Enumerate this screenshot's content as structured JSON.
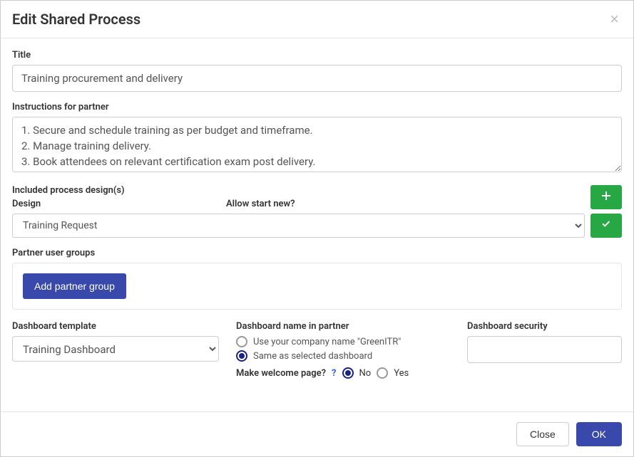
{
  "modal": {
    "title": "Edit Shared Process"
  },
  "form": {
    "title_label": "Title",
    "title_value": "Training procurement and delivery",
    "instructions_label": "Instructions for partner",
    "instructions_value": "1. Secure and schedule training as per budget and timeframe.\n2. Manage training delivery.\n3. Book attendees on relevant certification exam post delivery."
  },
  "included": {
    "label": "Included process design(s)",
    "design_label": "Design",
    "allow_label": "Allow start new?",
    "design_value": "Training Request"
  },
  "partner_groups": {
    "label": "Partner user groups",
    "add_button": "Add partner group"
  },
  "dashboard": {
    "template_label": "Dashboard template",
    "template_value": "Training Dashboard",
    "name_label": "Dashboard name in partner",
    "name_opt_company": "Use your company name \"GreenITR\"",
    "name_opt_same": "Same as selected dashboard",
    "welcome_label": "Make welcome page?",
    "welcome_no": "No",
    "welcome_yes": "Yes",
    "security_label": "Dashboard security",
    "security_value": ""
  },
  "footer": {
    "close": "Close",
    "ok": "OK"
  }
}
